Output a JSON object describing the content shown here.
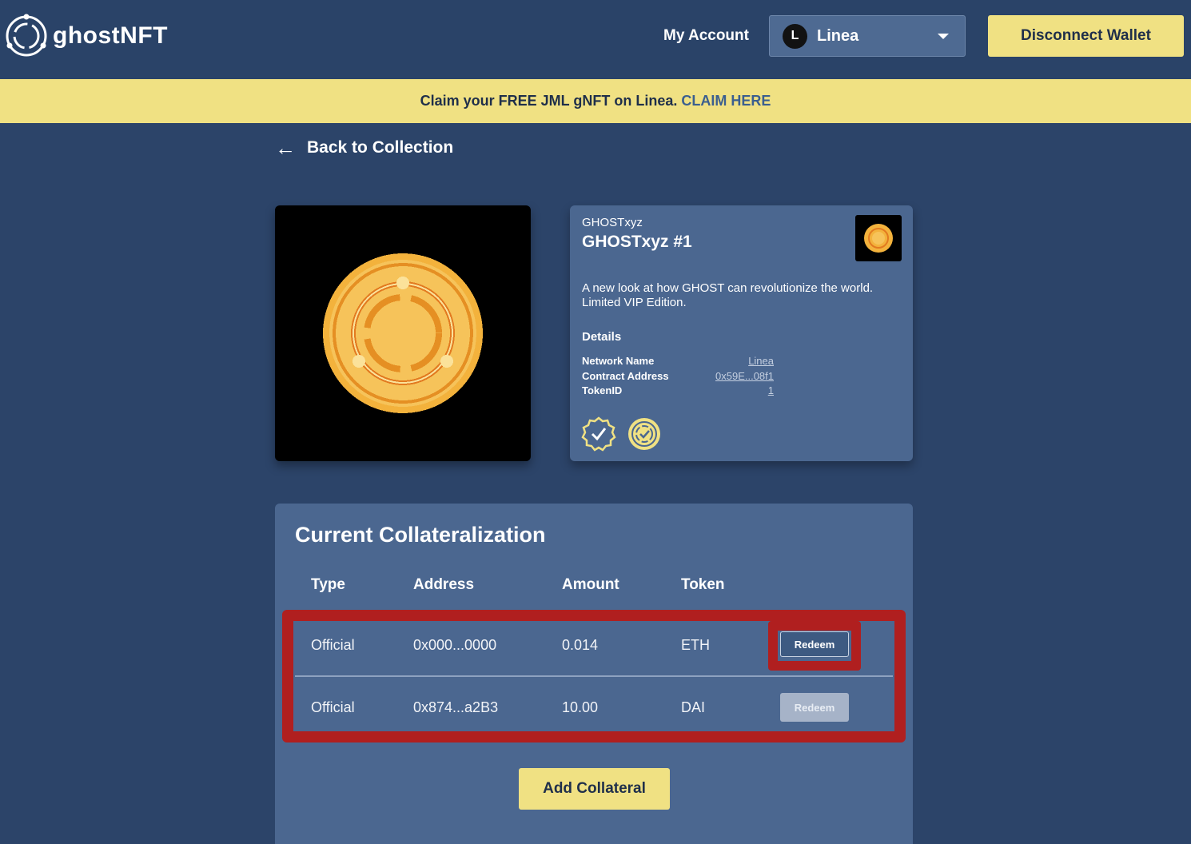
{
  "header": {
    "logo_text": "ghostNFT",
    "my_account": "My Account",
    "network": {
      "icon_letter": "L",
      "label": "Linea"
    },
    "disconnect_label": "Disconnect Wallet"
  },
  "banner": {
    "text": "Claim your FREE JML gNFT on Linea.",
    "link_text": "CLAIM HERE"
  },
  "back_label": "Back to Collection",
  "nft": {
    "collection": "GHOSTxyz",
    "title": "GHOSTxyz #1",
    "description": "A new look at how GHOST can revolutionize the world. Limited VIP Edition.",
    "details_heading": "Details",
    "details": [
      {
        "label": "Network Name",
        "value": "Linea"
      },
      {
        "label": "Contract Address",
        "value": "0x59E...08f1"
      },
      {
        "label": "TokenID",
        "value": "1"
      }
    ]
  },
  "collateral": {
    "title": "Current Collateralization",
    "columns": [
      "Type",
      "Address",
      "Amount",
      "Token"
    ],
    "rows": [
      {
        "type": "Official",
        "address": "0x000...0000",
        "amount": "0.014",
        "token": "ETH",
        "action": "Redeem",
        "enabled": true
      },
      {
        "type": "Official",
        "address": "0x874...a2B3",
        "amount": "10.00",
        "token": "DAI",
        "action": "Redeem",
        "enabled": false
      }
    ],
    "add_label": "Add Collateral"
  },
  "colors": {
    "background": "#2c4469",
    "card": "#4b6790",
    "accent_yellow": "#f0e183",
    "highlight_red": "#b01f1f"
  }
}
